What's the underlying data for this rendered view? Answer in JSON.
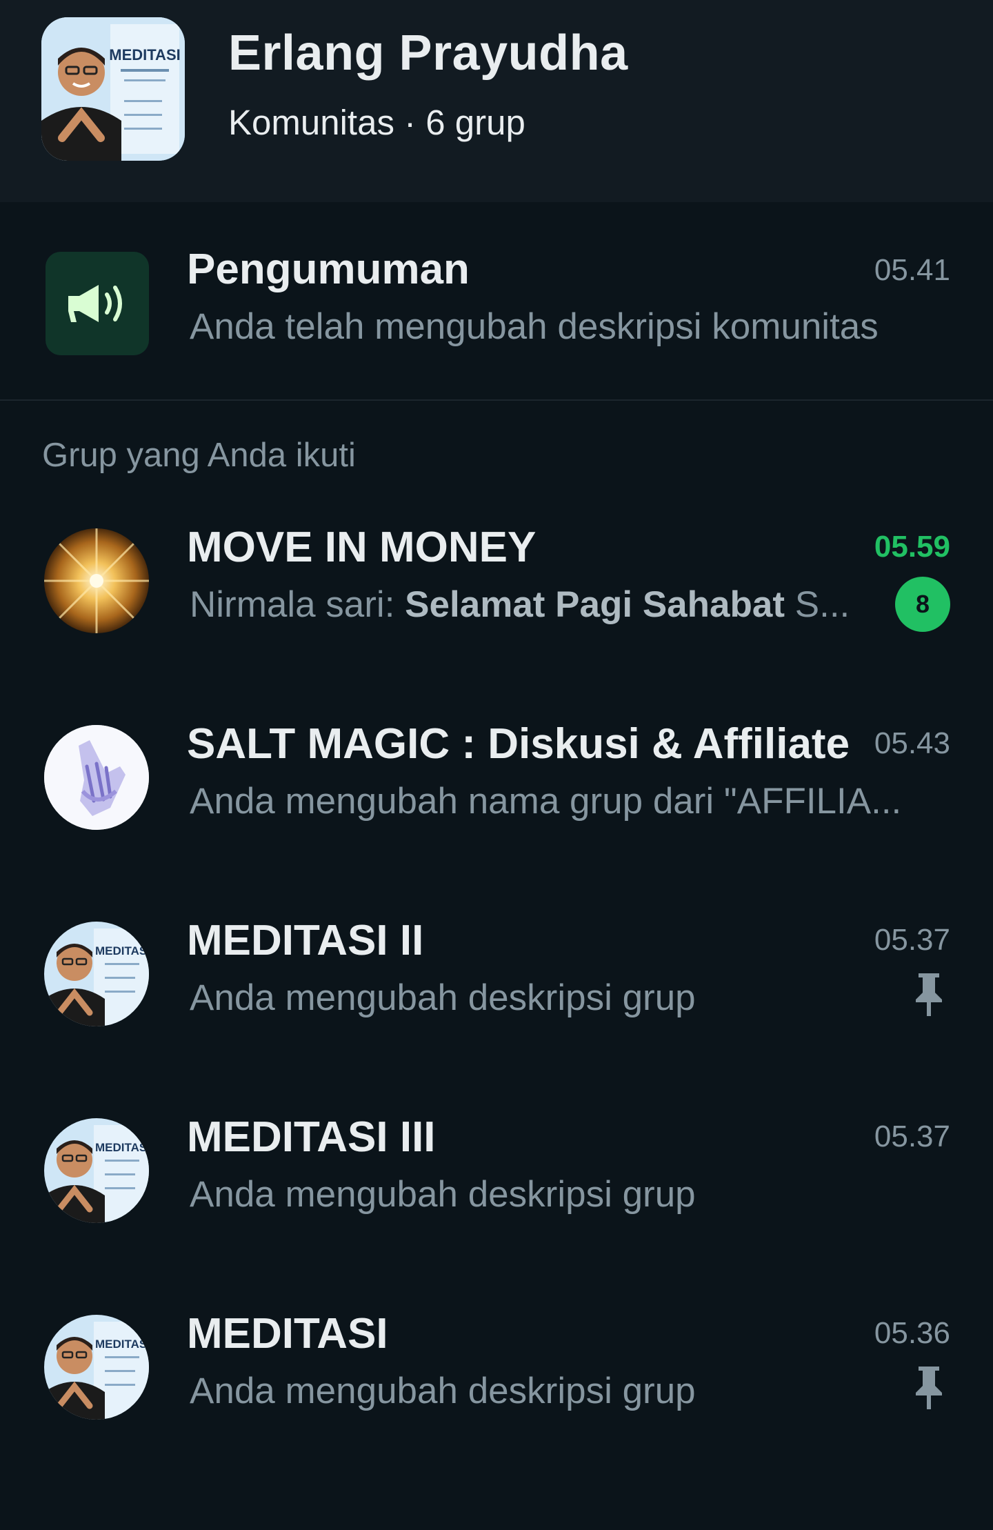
{
  "community": {
    "name": "Erlang Prayudha",
    "subtitle": "Komunitas · 6 grup",
    "avatar_icon": "community-avatar-meditasi-poster",
    "avatar_poster_text": "MEDITASI"
  },
  "announcement": {
    "title": "Pengumuman",
    "subtitle": "Anda telah mengubah deskripsi komunitas",
    "time": "05.41",
    "icon": "megaphone-icon"
  },
  "section_label": "Grup yang Anda ikuti",
  "groups": [
    {
      "name": "MOVE IN MONEY",
      "sender": "Nirmala sari:",
      "message": "Selamat Pagi Sahabat",
      "message_tail": "S...",
      "time": "05.59",
      "unread": "8",
      "avatar_icon": "golden-burst-avatar"
    },
    {
      "name": "SALT MAGIC : Diskusi & Affiliate",
      "message": "Anda mengubah nama grup dari \"AFFILIA...",
      "time": "05.43",
      "avatar_icon": "hands-avatar"
    },
    {
      "name": "MEDITASI II",
      "message": "Anda mengubah deskripsi grup",
      "time": "05.37",
      "pinned": true,
      "avatar_icon": "meditasi-poster-avatar",
      "avatar_poster_text": "MEDITASI"
    },
    {
      "name": "MEDITASI III",
      "message": "Anda mengubah deskripsi grup",
      "time": "05.37",
      "avatar_icon": "meditasi-poster-avatar",
      "avatar_poster_text": "MEDITASI"
    },
    {
      "name": "MEDITASI",
      "message": "Anda mengubah deskripsi grup",
      "time": "05.36",
      "pinned": true,
      "avatar_icon": "meditasi-poster-avatar",
      "avatar_poster_text": "MEDITASI"
    }
  ],
  "colors": {
    "background": "#0b141a",
    "header": "#121b22",
    "accent": "#21c063",
    "secondary_text": "#8696a0"
  }
}
